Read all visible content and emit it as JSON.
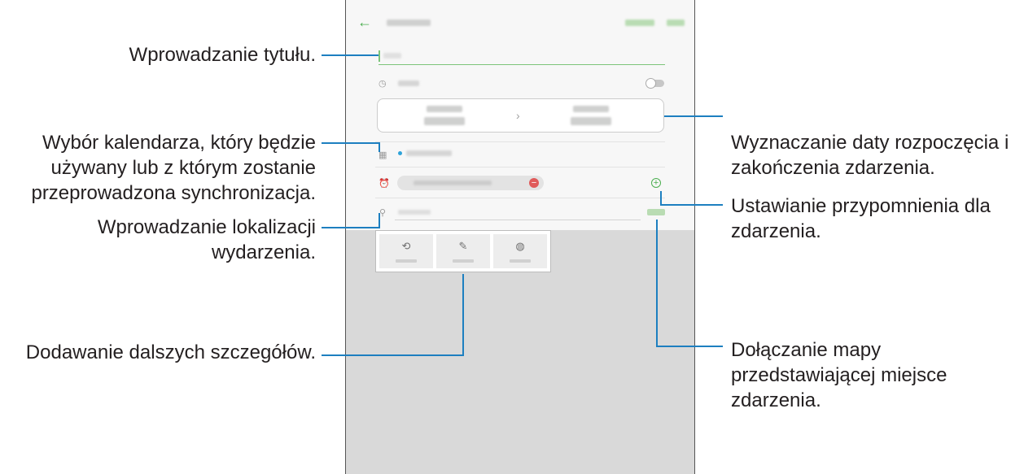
{
  "callouts": {
    "title": "Wprowadzanie tytułu.",
    "calendar": [
      "Wybór kalendarza, który będzie",
      "używany lub z którym zostanie",
      "przeprowadzona synchronizacja."
    ],
    "location": [
      "Wprowadzanie lokalizacji",
      "wydarzenia."
    ],
    "details": "Dodawanie dalszych szczegółów.",
    "dates": [
      "Wyznaczanie daty rozpoczęcia i",
      "zakończenia zdarzenia."
    ],
    "reminder": [
      "Ustawianie przypomnienia dla",
      "zdarzenia."
    ],
    "map": [
      "Dołączanie mapy",
      "przedstawiającej miejsce",
      "zdarzenia."
    ]
  },
  "device": {
    "date_separator": "›",
    "icons": {
      "back": "arrow-left-icon",
      "clock": "clock-icon",
      "calendar": "calendar-icon",
      "alarm": "alarm-icon",
      "location": "location-pin-icon",
      "repeat": "repeat-icon",
      "notes": "notes-icon",
      "timezone": "globe-icon"
    }
  },
  "colors": {
    "accent": "#4caf50",
    "leader_line": "#1d7fc0",
    "calendar_dot": "#2ea3d9",
    "remove": "#e05a5a"
  }
}
